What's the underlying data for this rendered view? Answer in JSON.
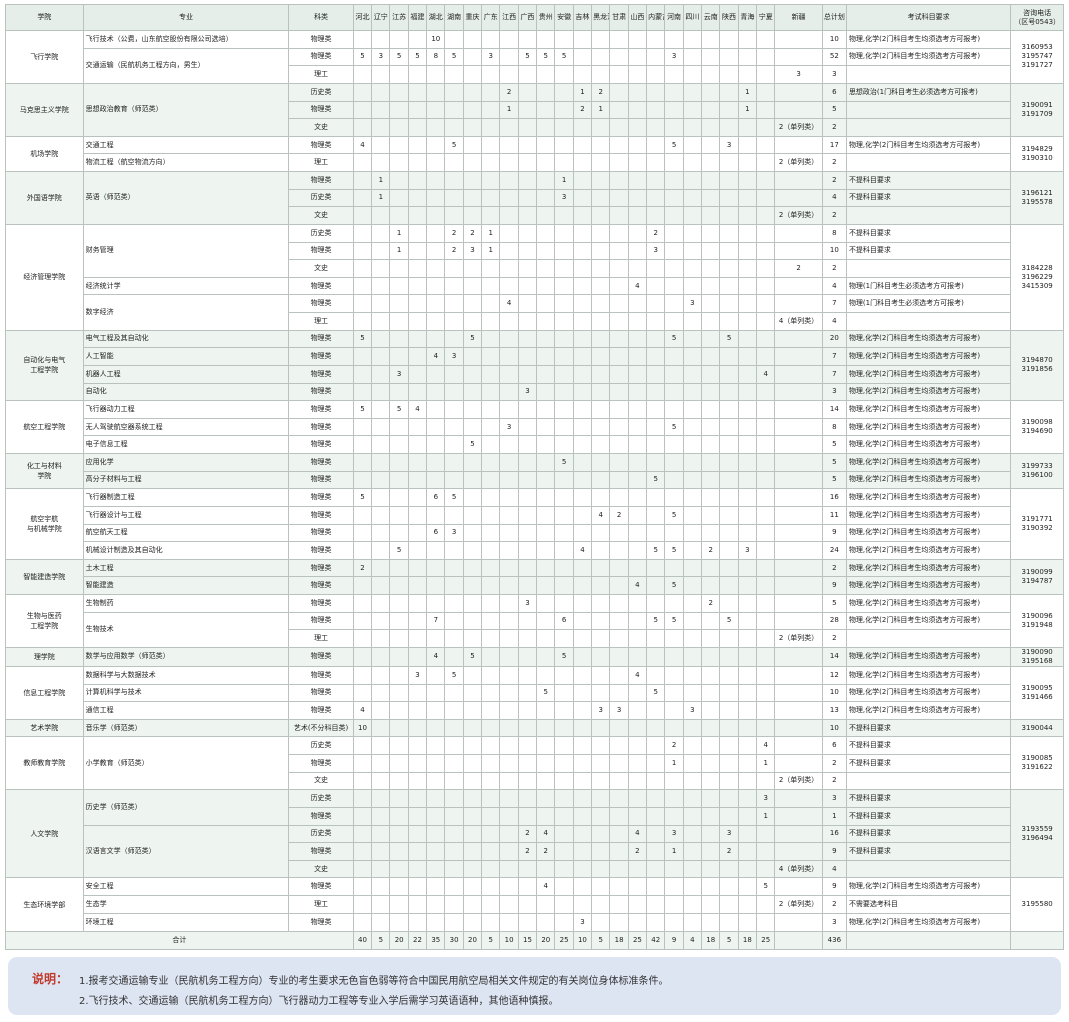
{
  "headers": {
    "college": "学院",
    "major": "专业",
    "category": "科类",
    "provinces": [
      "河北",
      "辽宁",
      "江苏",
      "福建",
      "湖北",
      "湖南",
      "重庆",
      "广东",
      "江西",
      "广西",
      "贵州",
      "安徽",
      "吉林",
      "黑龙江",
      "甘肃",
      "山西",
      "内蒙古",
      "河南",
      "四川",
      "云南",
      "陕西",
      "青海",
      "宁夏",
      "新疆"
    ],
    "total": "总计划",
    "requirement": "考试科目要求",
    "phone": "咨询电话\n（区号0543）"
  },
  "groups": [
    {
      "college": "飞行学院",
      "phone": "3160953\n3195747\n3191727",
      "rows": [
        {
          "major": "飞行技术（公费，山东航空股份有限公司选培）",
          "category": "物理类",
          "vals": {
            "湖北": "10"
          },
          "total": "10",
          "req": "物理,化学(2门科目考生均须选考方可报考)"
        },
        {
          "major": "交通运输（民航机务工程方向，男生）",
          "category": "物理类",
          "vals": {
            "河北": "5",
            "辽宁": "3",
            "江苏": "5",
            "福建": "5",
            "湖北": "8",
            "湖南": "5",
            "广东": "3",
            "广西": "5",
            "贵州": "5",
            "安徽": "5",
            "河南": "3"
          },
          "total": "52",
          "req": "物理,化学(2门科目考生均须选考方可报考)"
        },
        {
          "major": "",
          "category": "理工",
          "vals": {
            "新疆": "3"
          },
          "total": "3",
          "req": ""
        }
      ]
    },
    {
      "college": "马克思主义学院",
      "phone": "3190091\n3191709",
      "rows": [
        {
          "major": "思想政治教育（师范类）",
          "category": "历史类",
          "vals": {
            "江西": "2",
            "吉林": "1",
            "黑龙江": "2",
            "青海": "1"
          },
          "total": "6",
          "req": "思想政治(1门科目考生必须选考方可报考)"
        },
        {
          "major": "",
          "category": "物理类",
          "vals": {
            "江西": "1",
            "吉林": "2",
            "黑龙江": "1",
            "青海": "1"
          },
          "total": "5",
          "req": ""
        },
        {
          "major": "",
          "category": "文史",
          "vals": {
            "新疆": "2（单列类）"
          },
          "total": "2",
          "req": ""
        }
      ]
    },
    {
      "college": "机场学院",
      "phone": "3194829\n3190310",
      "rows": [
        {
          "major": "交通工程",
          "category": "物理类",
          "vals": {
            "河北": "4",
            "湖南": "5",
            "河南": "5",
            "陕西": "3"
          },
          "total": "17",
          "req": "物理,化学(2门科目考生均须选考方可报考)"
        },
        {
          "major": "物流工程（航空物流方向）",
          "category": "理工",
          "vals": {
            "新疆": "2（单列类）"
          },
          "total": "2",
          "req": ""
        }
      ]
    },
    {
      "college": "外国语学院",
      "phone": "3196121\n3195578",
      "rows": [
        {
          "major": "英语（师范类）",
          "category": "物理类",
          "vals": {
            "辽宁": "1",
            "安徽": "1"
          },
          "total": "2",
          "req": "不提科目要求"
        },
        {
          "major": "",
          "category": "历史类",
          "vals": {
            "辽宁": "1",
            "安徽": "3"
          },
          "total": "4",
          "req": "不提科目要求"
        },
        {
          "major": "",
          "category": "文史",
          "vals": {
            "新疆": "2（单列类）"
          },
          "total": "2",
          "req": ""
        }
      ]
    },
    {
      "college": "经济管理学院",
      "phone": "3184228\n3196229\n3415309",
      "rows": [
        {
          "major": "财务管理",
          "category": "历史类",
          "vals": {
            "江苏": "1",
            "湖南": "2",
            "重庆": "2",
            "广东": "1",
            "内蒙古": "2"
          },
          "total": "8",
          "req": "不提科目要求"
        },
        {
          "major": "",
          "category": "物理类",
          "vals": {
            "江苏": "1",
            "湖南": "2",
            "重庆": "3",
            "广东": "1",
            "内蒙古": "3"
          },
          "total": "10",
          "req": "不提科目要求"
        },
        {
          "major": "",
          "category": "文史",
          "vals": {
            "新疆": "2"
          },
          "total": "2",
          "req": ""
        },
        {
          "major": "经济统计学",
          "category": "物理类",
          "vals": {
            "山西": "4"
          },
          "total": "4",
          "req": "物理(1门科目考生必须选考方可报考)"
        },
        {
          "major": "数字经济",
          "category": "物理类",
          "vals": {
            "江西": "4",
            "四川": "3"
          },
          "total": "7",
          "req": "物理(1门科目考生必须选考方可报考)"
        },
        {
          "major": "",
          "category": "理工",
          "vals": {
            "新疆": "4（单列类）"
          },
          "total": "4",
          "req": ""
        }
      ]
    },
    {
      "college": "自动化与电气\n工程学院",
      "phone": "3194870\n3191856",
      "rows": [
        {
          "major": "电气工程及其自动化",
          "category": "物理类",
          "vals": {
            "河北": "5",
            "重庆": "5",
            "河南": "5",
            "陕西": "5"
          },
          "total": "20",
          "req": "物理,化学(2门科目考生均须选考方可报考)"
        },
        {
          "major": "人工智能",
          "category": "物理类",
          "vals": {
            "湖北": "4",
            "湖南": "3"
          },
          "total": "7",
          "req": "物理,化学(2门科目考生均须选考方可报考)"
        },
        {
          "major": "机器人工程",
          "category": "物理类",
          "vals": {
            "江苏": "3",
            "宁夏": "4"
          },
          "total": "7",
          "req": "物理,化学(2门科目考生均须选考方可报考)"
        },
        {
          "major": "自动化",
          "category": "物理类",
          "vals": {
            "广西": "3"
          },
          "total": "3",
          "req": "物理,化学(2门科目考生均须选考方可报考)"
        }
      ]
    },
    {
      "college": "航空工程学院",
      "phone": "3190098\n3194690",
      "rows": [
        {
          "major": "飞行器动力工程",
          "category": "物理类",
          "vals": {
            "河北": "5",
            "江苏": "5",
            "福建": "4"
          },
          "total": "14",
          "req": "物理,化学(2门科目考生均须选考方可报考)"
        },
        {
          "major": "无人驾驶航空器系统工程",
          "category": "物理类",
          "vals": {
            "江西": "3",
            "河南": "5"
          },
          "total": "8",
          "req": "物理,化学(2门科目考生均须选考方可报考)"
        },
        {
          "major": "电子信息工程",
          "category": "物理类",
          "vals": {
            "重庆": "5"
          },
          "total": "5",
          "req": "物理,化学(2门科目考生均须选考方可报考)"
        }
      ]
    },
    {
      "college": "化工与材料\n学院",
      "phone": "3199733\n3196100",
      "rows": [
        {
          "major": "应用化学",
          "category": "物理类",
          "vals": {
            "安徽": "5"
          },
          "total": "5",
          "req": "物理,化学(2门科目考生均须选考方可报考)"
        },
        {
          "major": "高分子材料与工程",
          "category": "物理类",
          "vals": {
            "内蒙古": "5"
          },
          "total": "5",
          "req": "物理,化学(2门科目考生均须选考方可报考)"
        }
      ]
    },
    {
      "college": "航空宇航\n与机械学院",
      "phone": "3191771\n3190392",
      "rows": [
        {
          "major": "飞行器制造工程",
          "category": "物理类",
          "vals": {
            "河北": "5",
            "湖北": "6",
            "湖南": "5"
          },
          "total": "16",
          "req": "物理,化学(2门科目考生均须选考方可报考)"
        },
        {
          "major": "飞行器设计与工程",
          "category": "物理类",
          "vals": {
            "黑龙江": "4",
            "甘肃": "2",
            "河南": "5"
          },
          "total": "11",
          "req": "物理,化学(2门科目考生均须选考方可报考)"
        },
        {
          "major": "航空航天工程",
          "category": "物理类",
          "vals": {
            "湖北": "6",
            "湖南": "3"
          },
          "total": "9",
          "req": "物理,化学(2门科目考生均须选考方可报考)"
        },
        {
          "major": "机械设计制造及其自动化",
          "category": "物理类",
          "vals": {
            "江苏": "5",
            "吉林": "4",
            "内蒙古": "5",
            "河南": "5",
            "云南": "2",
            "青海": "3"
          },
          "total": "24",
          "req": "物理,化学(2门科目考生均须选考方可报考)"
        }
      ]
    },
    {
      "college": "智能建造学院",
      "phone": "3190099\n3194787",
      "rows": [
        {
          "major": "土木工程",
          "category": "物理类",
          "vals": {
            "河北": "2"
          },
          "total": "2",
          "req": "物理,化学(2门科目考生均须选考方可报考)"
        },
        {
          "major": "智能建造",
          "category": "物理类",
          "vals": {
            "山西": "4",
            "河南": "5"
          },
          "total": "9",
          "req": "物理,化学(2门科目考生均须选考方可报考)"
        }
      ]
    },
    {
      "college": "生物与医药\n工程学院",
      "phone": "3190096\n3191948",
      "rows": [
        {
          "major": "生物制药",
          "category": "物理类",
          "vals": {
            "广西": "3",
            "云南": "2"
          },
          "total": "5",
          "req": "物理,化学(2门科目考生均须选考方可报考)"
        },
        {
          "major": "生物技术",
          "category": "物理类",
          "vals": {
            "湖北": "7",
            "安徽": "6",
            "内蒙古": "5",
            "河南": "5",
            "陕西": "5"
          },
          "total": "28",
          "req": "物理,化学(2门科目考生均须选考方可报考)"
        },
        {
          "major": "",
          "category": "理工",
          "vals": {
            "新疆": "2（单列类）"
          },
          "total": "2",
          "req": ""
        }
      ]
    },
    {
      "college": "理学院",
      "phone": "3190090\n3195168",
      "rows": [
        {
          "major": "数学与应用数学（师范类）",
          "category": "物理类",
          "vals": {
            "湖北": "4",
            "重庆": "5",
            "安徽": "5"
          },
          "total": "14",
          "req": "物理,化学(2门科目考生均须选考方可报考)"
        }
      ]
    },
    {
      "college": "信息工程学院",
      "phone": "3190095\n3191466",
      "rows": [
        {
          "major": "数据科学与大数据技术",
          "category": "物理类",
          "vals": {
            "福建": "3",
            "湖南": "5",
            "山西": "4"
          },
          "total": "12",
          "req": "物理,化学(2门科目考生均须选考方可报考)"
        },
        {
          "major": "计算机科学与技术",
          "category": "物理类",
          "vals": {
            "贵州": "5",
            "内蒙古": "5"
          },
          "total": "10",
          "req": "物理,化学(2门科目考生均须选考方可报考)"
        },
        {
          "major": "通信工程",
          "category": "物理类",
          "vals": {
            "河北": "4",
            "黑龙江": "3",
            "甘肃": "3",
            "四川": "3"
          },
          "total": "13",
          "req": "物理,化学(2门科目考生均须选考方可报考)"
        }
      ]
    },
    {
      "college": "艺术学院",
      "phone": "3190044",
      "rows": [
        {
          "major": "音乐学（师范类）",
          "category": "艺术(不分科目类)",
          "vals": {
            "河北": "10"
          },
          "total": "10",
          "req": "不提科目要求"
        }
      ]
    },
    {
      "college": "教师教育学院",
      "phone": "3190085\n3191622",
      "rows": [
        {
          "major": "小学教育（师范类）",
          "category": "历史类",
          "vals": {
            "河南": "2",
            "宁夏": "4"
          },
          "total": "6",
          "req": "不提科目要求"
        },
        {
          "major": "",
          "category": "物理类",
          "vals": {
            "河南": "1",
            "宁夏": "1"
          },
          "total": "2",
          "req": "不提科目要求"
        },
        {
          "major": "",
          "category": "文史",
          "vals": {
            "新疆": "2（单列类）"
          },
          "total": "2",
          "req": ""
        }
      ]
    },
    {
      "college": "人文学院",
      "phone": "3193559\n3196494",
      "rows": [
        {
          "major": "历史学（师范类）",
          "category": "历史类",
          "vals": {
            "宁夏": "3"
          },
          "total": "3",
          "req": "不提科目要求"
        },
        {
          "major": "",
          "category": "物理类",
          "vals": {
            "宁夏": "1"
          },
          "total": "1",
          "req": "不提科目要求"
        },
        {
          "major": "汉语言文学（师范类）",
          "category": "历史类",
          "vals": {
            "广西": "2",
            "贵州": "4",
            "山西": "4",
            "河南": "3",
            "陕西": "3"
          },
          "total": "16",
          "req": "不提科目要求"
        },
        {
          "major": "",
          "category": "物理类",
          "vals": {
            "广西": "2",
            "贵州": "2",
            "山西": "2",
            "河南": "1",
            "陕西": "2"
          },
          "total": "9",
          "req": "不提科目要求"
        },
        {
          "major": "",
          "category": "文史",
          "vals": {
            "新疆": "4（单列类）"
          },
          "total": "4",
          "req": ""
        }
      ]
    },
    {
      "college": "生态环境学部",
      "phone": "3195580",
      "rows": [
        {
          "major": "安全工程",
          "category": "物理类",
          "vals": {
            "贵州": "4",
            "宁夏": "5"
          },
          "total": "9",
          "req": "物理,化学(2门科目考生均须选考方可报考)"
        },
        {
          "major": "生态学",
          "category": "理工",
          "vals": {
            "新疆": "2（单列类）"
          },
          "total": "2",
          "req": "不需要选考科目"
        },
        {
          "major": "环境工程",
          "category": "物理类",
          "vals": {
            "吉林": "3"
          },
          "total": "3",
          "req": "物理,化学(2门科目考生均须选考方可报考)"
        }
      ]
    }
  ],
  "footer": {
    "label": "合计",
    "vals": [
      "40",
      "5",
      "20",
      "22",
      "35",
      "30",
      "20",
      "5",
      "10",
      "15",
      "20",
      "25",
      "10",
      "5",
      "18",
      "25",
      "42",
      "9",
      "4",
      "18",
      "5",
      "18",
      "25"
    ],
    "total": "436"
  },
  "notes": {
    "label": "说明：",
    "line1": "1.报考交通运输专业（民航机务工程方向）专业的考生要求无色盲色弱等符合中国民用航空局相关文件规定的有关岗位身体标准条件。",
    "line2": "2.飞行技术、交通运输（民航机务工程方向）飞行器动力工程等专业入学后需学习英语语种，其他语种慎报。"
  },
  "colors": {
    "header_bg": "#e6eee9",
    "row_shade": "#eef4f0",
    "border": "#b9c2bd",
    "note_bg": "#dde4f2",
    "note_label": "#c0392b"
  }
}
